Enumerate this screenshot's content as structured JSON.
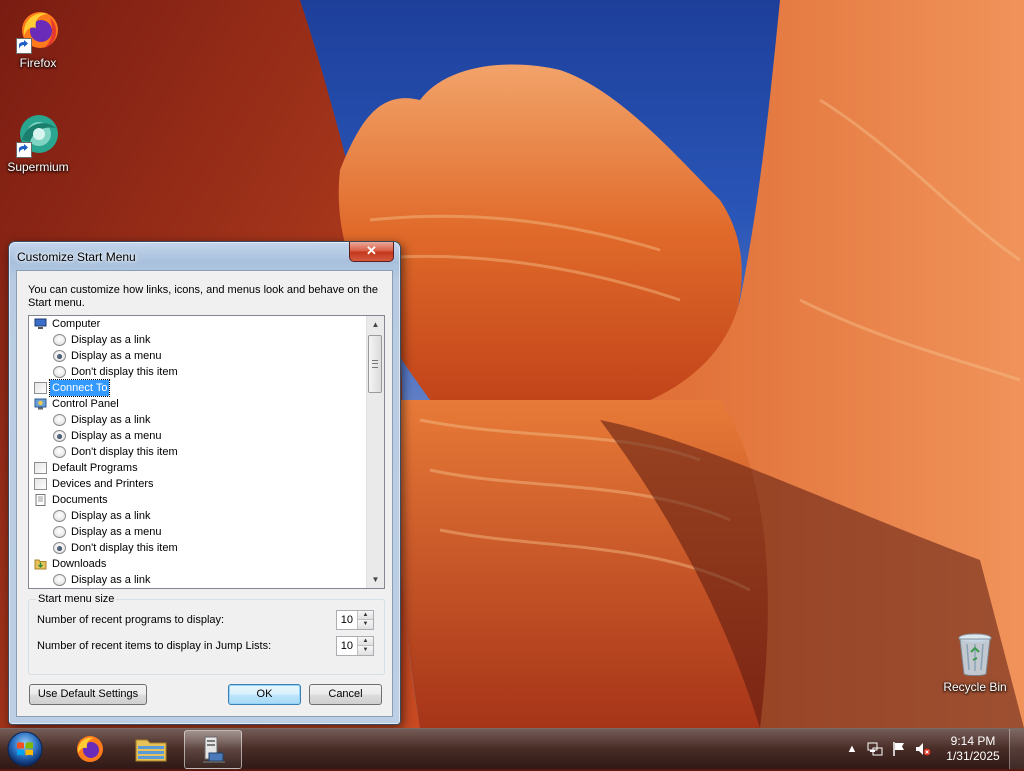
{
  "desktop": {
    "icons": [
      {
        "label": "Firefox",
        "icon": "firefox-icon"
      },
      {
        "label": "Supermium",
        "icon": "supermium-icon"
      },
      {
        "label": "Recycle Bin",
        "icon": "recycle-bin-icon"
      }
    ]
  },
  "dialog": {
    "title": "Customize Start Menu",
    "close_symbol": "✕",
    "intro": "You can customize how links, icons, and menus look and behave on the Start menu.",
    "list_items": [
      {
        "type": "category",
        "label": "Computer",
        "icon": "computer-icon"
      },
      {
        "type": "radio",
        "label": "Display as a link",
        "checked": false
      },
      {
        "type": "radio",
        "label": "Display as a menu",
        "checked": true
      },
      {
        "type": "radio",
        "label": "Don't display this item",
        "checked": false
      },
      {
        "type": "checkbox",
        "label": "Connect To",
        "checked": false,
        "selected": true
      },
      {
        "type": "category",
        "label": "Control Panel",
        "icon": "control-panel-icon"
      },
      {
        "type": "radio",
        "label": "Display as a link",
        "checked": false
      },
      {
        "type": "radio",
        "label": "Display as a menu",
        "checked": true
      },
      {
        "type": "radio",
        "label": "Don't display this item",
        "checked": false
      },
      {
        "type": "checkbox",
        "label": "Default Programs",
        "checked": false
      },
      {
        "type": "checkbox",
        "label": "Devices and Printers",
        "checked": false
      },
      {
        "type": "category",
        "label": "Documents",
        "icon": "documents-icon"
      },
      {
        "type": "radio",
        "label": "Display as a link",
        "checked": false
      },
      {
        "type": "radio",
        "label": "Display as a menu",
        "checked": false
      },
      {
        "type": "radio",
        "label": "Don't display this item",
        "checked": true
      },
      {
        "type": "category",
        "label": "Downloads",
        "icon": "downloads-icon"
      },
      {
        "type": "radio",
        "label": "Display as a link",
        "checked": false
      }
    ],
    "start_menu_size": {
      "group_label": "Start menu size",
      "recent_programs_label": "Number of recent programs to display:",
      "recent_programs_value": "10",
      "recent_items_label": "Number of recent items to display in Jump Lists:",
      "recent_items_value": "10"
    },
    "buttons": {
      "use_default": "Use Default Settings",
      "ok": "OK",
      "cancel": "Cancel"
    }
  },
  "taskbar": {
    "pinned": [
      "start-orb-icon",
      "firefox-icon",
      "file-explorer-icon",
      "customize-start-menu-icon"
    ],
    "tray": [
      "show-hidden-icons-icon",
      "network-icon",
      "action-center-flag-icon",
      "volume-muted-icon"
    ],
    "clock_time": "9:14 PM",
    "clock_date": "1/31/2025"
  }
}
